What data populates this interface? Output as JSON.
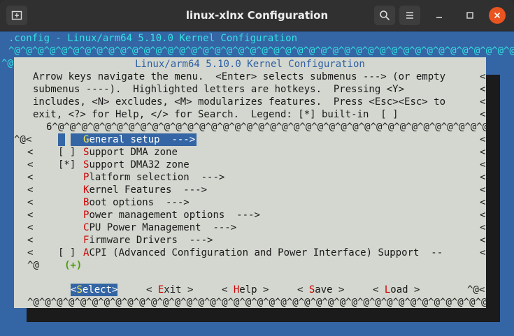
{
  "window": {
    "title": "linux-xlnx Configuration"
  },
  "terminal": {
    "header_line": ".config - Linux/arm64 5.10.0 Kernel Configuration",
    "caret_line": "^@^@^@^@^@^@^@^@^@^@^@^@^@^@^@^@^@^@^@^@^@^@^@^@^@^@^@^@^@^@^@^@^@^@^@^@^@^@^@^@^@^@^@^@^@",
    "caret_short": "^@"
  },
  "dialog": {
    "title": "Linux/arm64 5.10.0 Kernel Configuration",
    "help_lines": [
      "Arrow keys navigate the menu.  <Enter> selects submenus ---> (or empty",
      "submenus ----).  Highlighted letters are hotkeys.  Pressing <Y>",
      "includes, <N> excludes, <M> modularizes features.  Press <Esc><Esc> to",
      "exit, <?> for Help, </> for Search.  Legend: [*] built-in  [ ]"
    ],
    "right_marker": "<",
    "top_border": "6^@^@^@^@^@^@^@^@^@^@^@^@^@^@^@^@^@^@^@^@^@^@^@^@^@^@^@^@^@^@^@^@^@^@^@^@^@",
    "bottom_border": "^@^@^@^@^@^@^@^@^@^@^@^@^@^@^@^@^@^@^@^@^@^@^@^@^@^@^@^@^@^@^@^@^@^@^@^@^@^@^@5",
    "first_row_prefix": "^@<",
    "row_prefix": "<",
    "more_prefix": "^@",
    "more_indicator": "(+)",
    "items": [
      {
        "check": "",
        "hot": "G",
        "rest": "eneral setup  --->",
        "selected": true
      },
      {
        "check": "[ ]",
        "hot": "S",
        "rest": "upport DMA zone",
        "selected": false
      },
      {
        "check": "[*]",
        "hot": "S",
        "rest": "upport DMA32 zone",
        "selected": false
      },
      {
        "check": "",
        "hot": "P",
        "rest": "latform selection  --->",
        "selected": false
      },
      {
        "check": "",
        "hot": "K",
        "rest": "ernel Features  --->",
        "selected": false
      },
      {
        "check": "",
        "hot": "B",
        "rest": "oot options  --->",
        "selected": false
      },
      {
        "check": "",
        "hot": "P",
        "rest": "ower management options  --->",
        "selected": false
      },
      {
        "check": "",
        "hot": "C",
        "rest": "PU Power Management  --->",
        "selected": false
      },
      {
        "check": "",
        "hot": "F",
        "rest": "irmware Drivers  --->",
        "selected": false
      },
      {
        "check": "[ ]",
        "hot": "A",
        "rest": "CPI (Advanced Configuration and Power Interface) Support  --",
        "selected": false
      }
    ],
    "buttons": [
      {
        "pre": "<",
        "hot": "S",
        "rest": "elect",
        "post": ">",
        "selected": true
      },
      {
        "pre": "< ",
        "hot": "E",
        "rest": "xit",
        "post": " >",
        "selected": false
      },
      {
        "pre": "< ",
        "hot": "H",
        "rest": "elp",
        "post": " >",
        "selected": false
      },
      {
        "pre": "< ",
        "hot": "S",
        "rest": "ave",
        "post": " >",
        "selected": false
      },
      {
        "pre": "< ",
        "hot": "L",
        "rest": "oad",
        "post": " >",
        "selected": false
      }
    ],
    "button_tail": "^@<"
  }
}
